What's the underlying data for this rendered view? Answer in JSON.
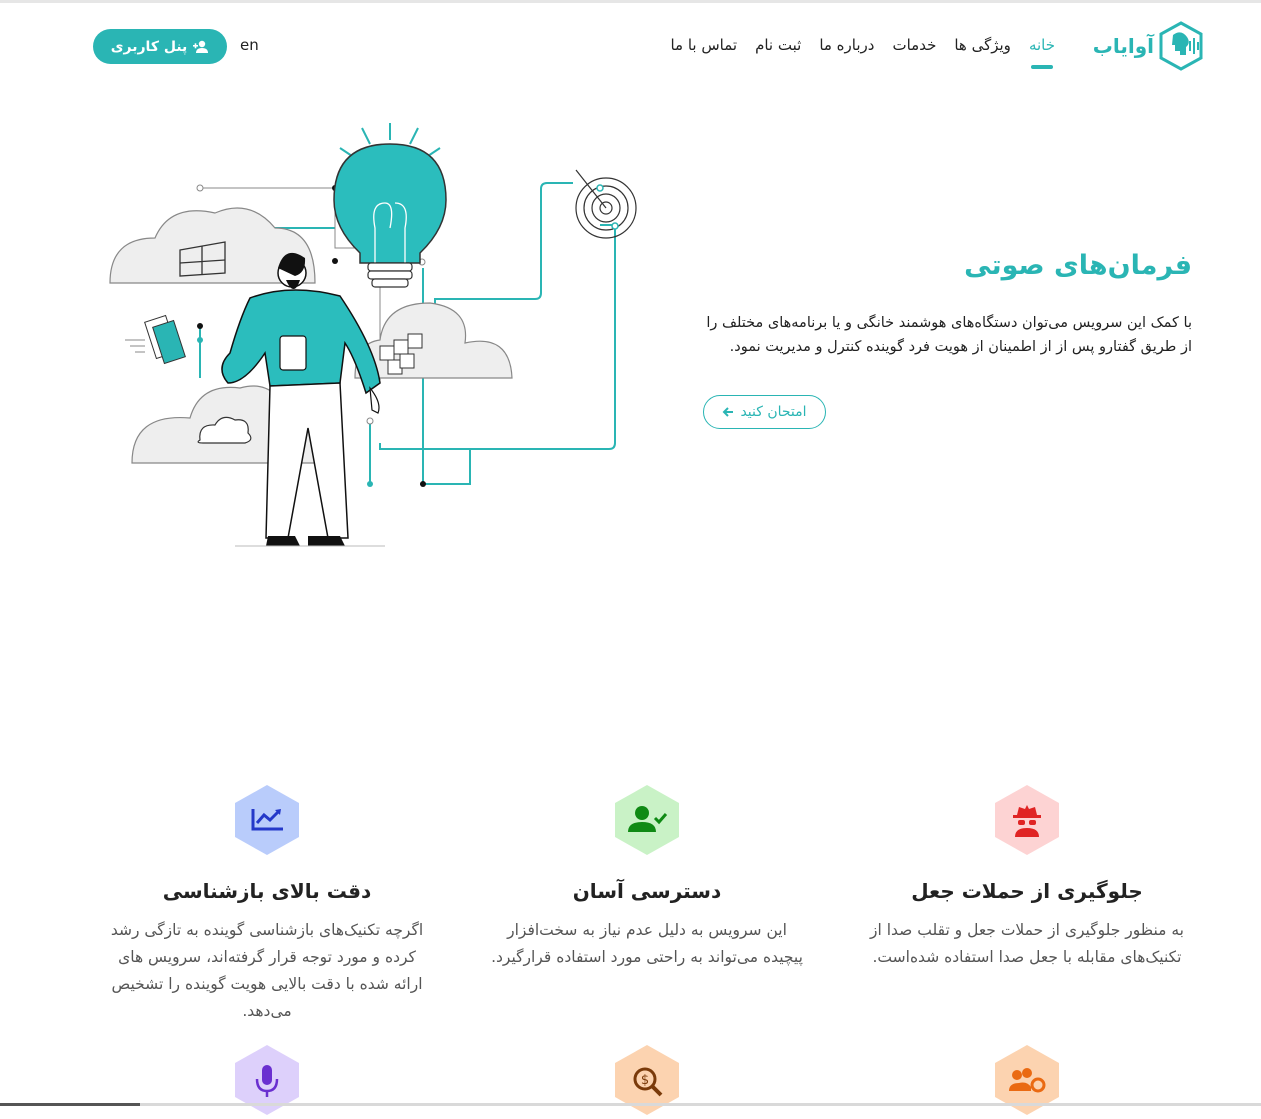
{
  "header": {
    "logo_text": "آوایاب",
    "nav": [
      {
        "label": "خانه",
        "active": true
      },
      {
        "label": "ویژگی ها",
        "active": false
      },
      {
        "label": "خدمات",
        "active": false
      },
      {
        "label": "درباره ما",
        "active": false
      },
      {
        "label": "ثبت نام",
        "active": false
      },
      {
        "label": "تماس با ما",
        "active": false
      }
    ],
    "lang_label": "en",
    "panel_button": "پنل کاربری"
  },
  "hero": {
    "title": "فرمان‌های صوتی",
    "description": "با کمک این سرویس می‌توان دستگاه‌های هوشمند خانگی و یا برنامه‌های مختلف را از طریق گفتارو پس از از اطمینان از هویت فرد گوینده کنترل و مدیریت نمود.",
    "try_button": "امتحان کنید"
  },
  "features": [
    {
      "title": "جلوگیری از حملات جعل",
      "description": "به منظور جلوگیری از حملات جعل و تقلب صدا از تکنیک‌های مقابله با جعل صدا استفاده شده‌است.",
      "icon": "spy-icon",
      "bg": "#fdd3d3",
      "fg": "#e02424"
    },
    {
      "title": "دسترسی آسان",
      "description": "این سرویس به دلیل عدم نیاز به سخت‌افزار پیچیده می‌تواند به راحتی مورد استفاده قرارگیرد.",
      "icon": "user-check-icon",
      "bg": "#c9f2c6",
      "fg": "#0f8a14"
    },
    {
      "title": "دقت بالای بازشناسی",
      "description": "اگرچه تکنیک‌های بازشناسی گوینده به تازگی رشد کرده و مورد توجه قرار گرفته‌اند، سرویس های ارائه شده با دقت بالایی هویت گوینده را تشخیص می‌دهد.",
      "icon": "chart-line-icon",
      "bg": "#b9ccfb",
      "fg": "#2438c9"
    }
  ],
  "more_features_icons": [
    {
      "icon": "users-cog-icon",
      "bg": "#fcd3b0",
      "fg": "#ea6a12"
    },
    {
      "icon": "search-dollar-icon",
      "bg": "#fcd3b0",
      "fg": "#7a3a0a"
    },
    {
      "icon": "microphone-icon",
      "bg": "#ddd0fb",
      "fg": "#6a2fd0"
    }
  ]
}
